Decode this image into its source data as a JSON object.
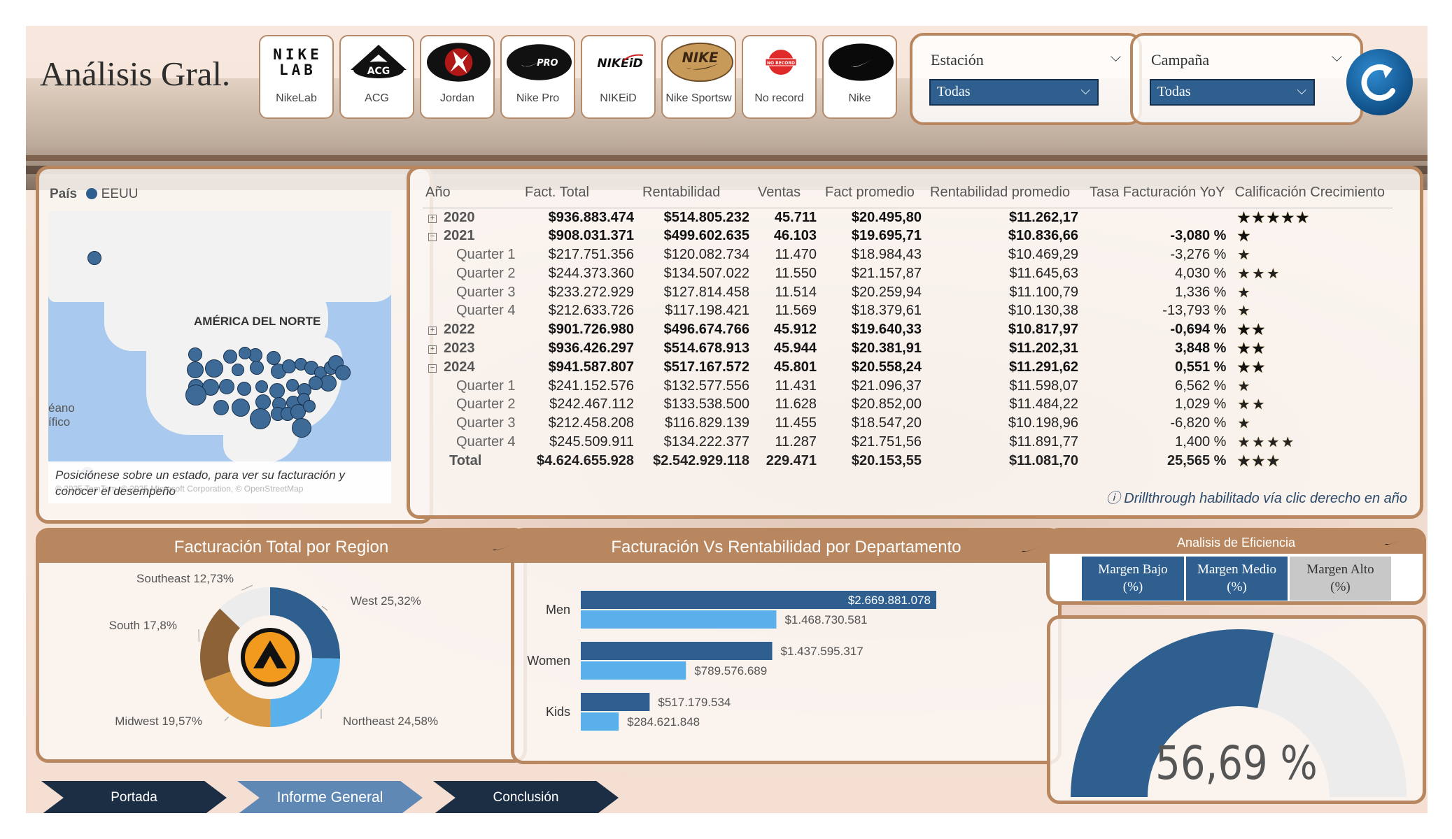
{
  "page": {
    "title": "Análisis Gral."
  },
  "brands": [
    {
      "label": "NikeLab",
      "logo_text": "NIKE LAB"
    },
    {
      "label": "ACG",
      "logo_text": "ACG"
    },
    {
      "label": "Jordan",
      "logo_text": ""
    },
    {
      "label": "Nike Pro",
      "logo_text": "PRO"
    },
    {
      "label": "NIKEiD",
      "logo_text": "NIKEiD"
    },
    {
      "label": "Nike Sportsw",
      "logo_text": "NIKE"
    },
    {
      "label": "No record",
      "logo_text": "NO RECORD"
    },
    {
      "label": "Nike",
      "logo_text": ""
    }
  ],
  "slicers": {
    "estacion": {
      "title": "Estación",
      "value": "Todas"
    },
    "campana": {
      "title": "Campaña",
      "value": "Todas"
    }
  },
  "map": {
    "legend_label": "País",
    "legend_value": "EEUU",
    "region_label": "AMÉRICA DEL NORTE",
    "ocean_label_1": "éano",
    "ocean_label_2": "ífico",
    "caption": "Posiciónese sobre un estado, para ver su facturación y conocer el desempeño",
    "attribution": "© 2025 TomTom, © 2025 Microsoft Corporation, © OpenStreetMap"
  },
  "matrix": {
    "columns": [
      "Año",
      "Fact. Total",
      "Rentabilidad",
      "Ventas",
      "Fact promedio",
      "Rentabilidad promedio",
      "Tasa Facturación YoY",
      "Calificación Crecimiento"
    ],
    "rows": [
      {
        "type": "year",
        "toggle": "+",
        "label": "2020",
        "fact": "$936.883.474",
        "rent": "$514.805.232",
        "ventas": "45.711",
        "fprom": "$20.495,80",
        "rprom": "$11.262,17",
        "yoy": "",
        "stars": "★★★★★"
      },
      {
        "type": "year",
        "toggle": "−",
        "label": "2021",
        "fact": "$908.031.371",
        "rent": "$499.602.635",
        "ventas": "46.103",
        "fprom": "$19.695,71",
        "rprom": "$10.836,66",
        "yoy": "-3,080 %",
        "stars": "★"
      },
      {
        "type": "q",
        "label": "Quarter 1",
        "fact": "$217.751.356",
        "rent": "$120.082.734",
        "ventas": "11.470",
        "fprom": "$18.984,43",
        "rprom": "$10.469,29",
        "yoy": "-3,276 %",
        "stars": "★"
      },
      {
        "type": "q",
        "label": "Quarter 2",
        "fact": "$244.373.360",
        "rent": "$134.507.022",
        "ventas": "11.550",
        "fprom": "$21.157,87",
        "rprom": "$11.645,63",
        "yoy": "4,030 %",
        "stars": "★★★"
      },
      {
        "type": "q",
        "label": "Quarter 3",
        "fact": "$233.272.929",
        "rent": "$127.814.458",
        "ventas": "11.514",
        "fprom": "$20.259,94",
        "rprom": "$11.100,79",
        "yoy": "1,336 %",
        "stars": "★"
      },
      {
        "type": "q",
        "label": "Quarter 4",
        "fact": "$212.633.726",
        "rent": "$117.198.421",
        "ventas": "11.569",
        "fprom": "$18.379,61",
        "rprom": "$10.130,38",
        "yoy": "-13,793 %",
        "stars": "★"
      },
      {
        "type": "year",
        "toggle": "+",
        "label": "2022",
        "fact": "$901.726.980",
        "rent": "$496.674.766",
        "ventas": "45.912",
        "fprom": "$19.640,33",
        "rprom": "$10.817,97",
        "yoy": "-0,694 %",
        "stars": "★★"
      },
      {
        "type": "year",
        "toggle": "+",
        "label": "2023",
        "fact": "$936.426.297",
        "rent": "$514.678.913",
        "ventas": "45.944",
        "fprom": "$20.381,91",
        "rprom": "$11.202,31",
        "yoy": "3,848 %",
        "stars": "★★"
      },
      {
        "type": "year",
        "toggle": "−",
        "label": "2024",
        "fact": "$941.587.807",
        "rent": "$517.167.572",
        "ventas": "45.801",
        "fprom": "$20.558,24",
        "rprom": "$11.291,62",
        "yoy": "0,551 %",
        "stars": "★★"
      },
      {
        "type": "q",
        "label": "Quarter 1",
        "fact": "$241.152.576",
        "rent": "$132.577.556",
        "ventas": "11.431",
        "fprom": "$21.096,37",
        "rprom": "$11.598,07",
        "yoy": "6,562 %",
        "stars": "★"
      },
      {
        "type": "q",
        "label": "Quarter 2",
        "fact": "$242.467.112",
        "rent": "$133.538.500",
        "ventas": "11.628",
        "fprom": "$20.852,00",
        "rprom": "$11.484,22",
        "yoy": "1,029 %",
        "stars": "★★"
      },
      {
        "type": "q",
        "label": "Quarter 3",
        "fact": "$212.458.208",
        "rent": "$116.829.139",
        "ventas": "11.455",
        "fprom": "$18.547,20",
        "rprom": "$10.198,96",
        "yoy": "-6,820 %",
        "stars": "★"
      },
      {
        "type": "q",
        "label": "Quarter 4",
        "fact": "$245.509.911",
        "rent": "$134.222.377",
        "ventas": "11.287",
        "fprom": "$21.751,56",
        "rprom": "$11.891,77",
        "yoy": "1,400 %",
        "stars": "★★★★"
      },
      {
        "type": "total",
        "label": "Total",
        "fact": "$4.624.655.928",
        "rent": "$2.542.929.118",
        "ventas": "229.471",
        "fprom": "$20.153,55",
        "rprom": "$11.081,70",
        "yoy": "25,565 %",
        "stars": "★★★"
      }
    ],
    "drill_note": "ⓘ Drillthrough habilitado vía clic derecho en año"
  },
  "donut": {
    "title": "Facturación Total por Region",
    "segments": [
      {
        "name": "West",
        "label": "West 25,32%",
        "value": 25.32,
        "color": "#2e5f8e"
      },
      {
        "name": "Northeast",
        "label": "Northeast 24,58%",
        "value": 24.58,
        "color": "#5ab0ea"
      },
      {
        "name": "Midwest",
        "label": "Midwest 19,57%",
        "value": 19.57,
        "color": "#d99a47"
      },
      {
        "name": "South",
        "label": "South 17,8%",
        "value": 17.8,
        "color": "#8c6236"
      },
      {
        "name": "Southeast",
        "label": "Southeast 12,73%",
        "value": 12.73,
        "color": "#ececec"
      }
    ]
  },
  "chart_data": {
    "type": "bar",
    "title": "Facturación Vs Rentabilidad por Departamento",
    "categories": [
      "Men",
      "Women",
      "Kids"
    ],
    "series": [
      {
        "values": [
          2669881078,
          1437595317,
          517179534
        ],
        "color": "#2e5f8e"
      },
      {
        "values": [
          1468730581,
          789576689,
          284621848
        ],
        "color": "#5ab0ea"
      }
    ],
    "value_labels": [
      [
        "$2.669.881.078",
        "$1.437.595.317",
        "$517.179.534"
      ],
      [
        "$1.468.730.581",
        "$789.576.689",
        "$284.621.848"
      ]
    ],
    "xlim": [
      0,
      2669881078
    ]
  },
  "efficiency": {
    "title": "Analisis de Eficiencia",
    "buttons": [
      {
        "label": "Margen Bajo (%)",
        "line1": "Margen Bajo",
        "line2": "(%)"
      },
      {
        "label": "Margen Medio (%)",
        "line1": "Margen Medio",
        "line2": "(%)"
      },
      {
        "label": "Margen Alto (%)",
        "line1": "Margen Alto",
        "line2": "(%)"
      }
    ]
  },
  "gauge": {
    "value": 56.69,
    "display": "56,69 %",
    "color": "#2e5f8e",
    "track_color": "#ececec"
  },
  "nav": [
    {
      "label": "Portada",
      "active": false
    },
    {
      "label": "Informe General",
      "active": true
    },
    {
      "label": "Conclusión",
      "active": false
    }
  ]
}
